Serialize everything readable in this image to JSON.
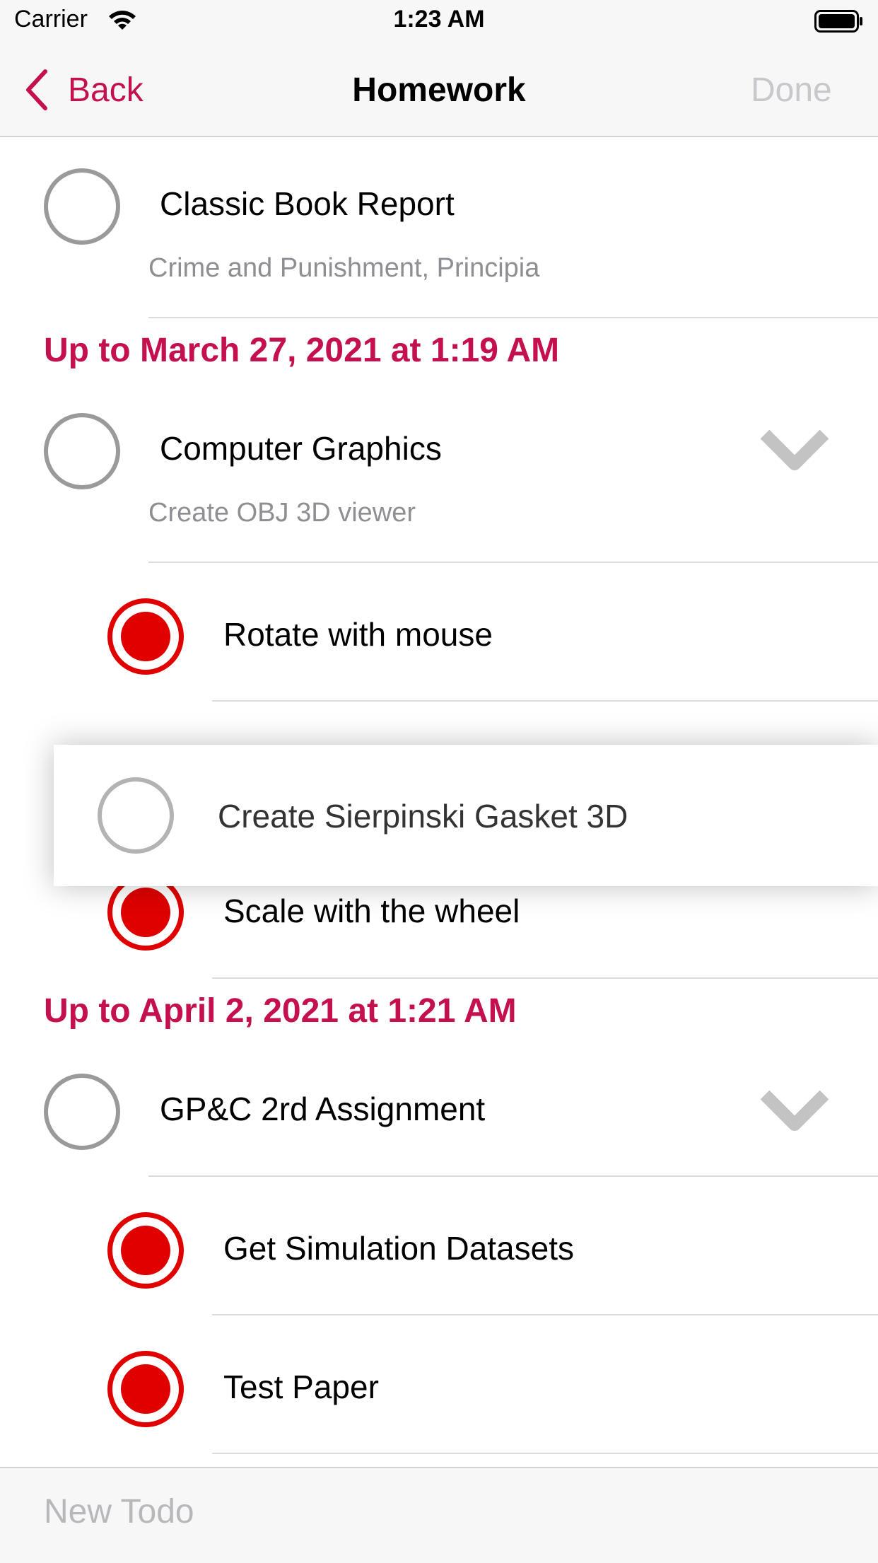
{
  "status_bar": {
    "carrier": "Carrier",
    "time": "1:23 AM"
  },
  "nav": {
    "back_label": "Back",
    "title": "Homework",
    "done_label": "Done"
  },
  "colors": {
    "accent": "#c4104f",
    "completed": "#e00000",
    "disabled": "#c7c7cc"
  },
  "list": {
    "item_classic": {
      "title": "Classic Book Report",
      "subtitle": "Crime and Punishment, Principia",
      "completed": false
    },
    "section_1": "Up to March 27, 2021 at 1:19 AM",
    "item_graphics": {
      "title": "Computer Graphics",
      "subtitle": "Create OBJ 3D viewer",
      "completed": false,
      "expand_icon": "chevron-down-icon"
    },
    "sub_rotate": {
      "title": "Rotate with mouse",
      "completed": true
    },
    "sub_scale": {
      "title": "Scale with the wheel",
      "completed": true
    },
    "dragging": {
      "title": "Create Sierpinski Gasket 3D",
      "completed": false
    },
    "section_2": "Up to April 2, 2021 at 1:21 AM",
    "item_gpc": {
      "title": "GP&C 2rd Assignment",
      "completed": false,
      "expand_icon": "chevron-down-icon"
    },
    "sub_datasets": {
      "title": "Get Simulation Datasets",
      "completed": true
    },
    "sub_paper": {
      "title": "Test Paper",
      "completed": true
    }
  },
  "bottom": {
    "new_todo_placeholder": "New Todo"
  }
}
